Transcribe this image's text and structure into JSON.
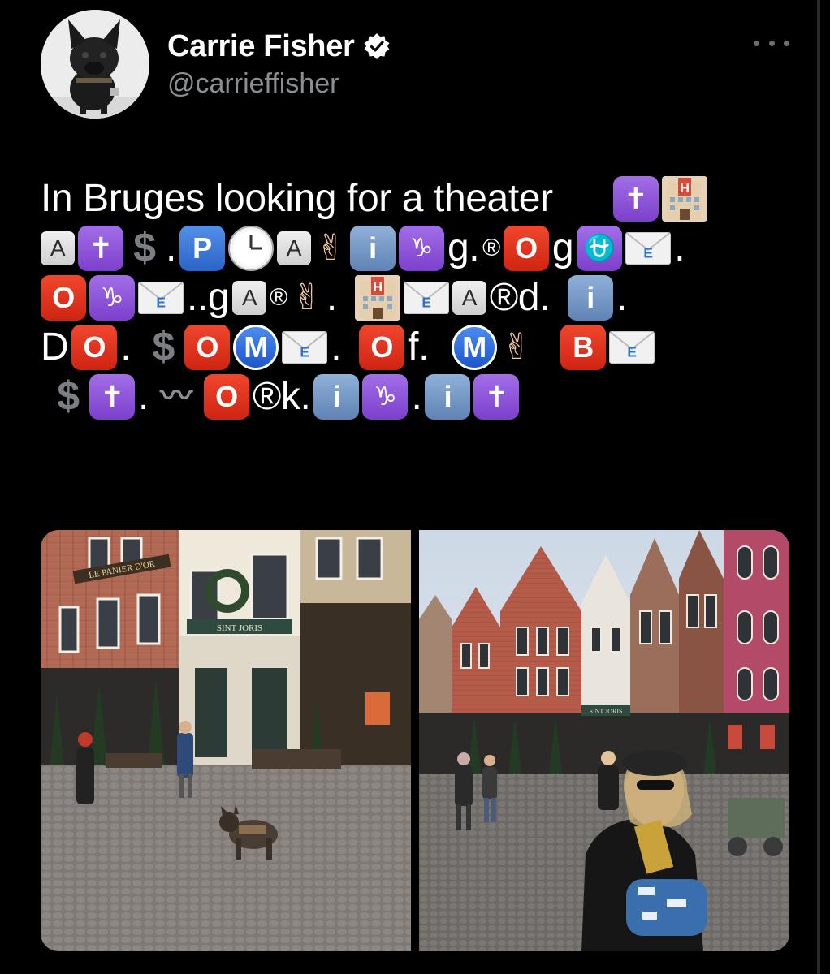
{
  "user": {
    "display_name": "Carrie Fisher",
    "handle": "@carrieffisher",
    "verified_icon": "verified-badge-icon",
    "avatar_icon": "dog-avatar-icon"
  },
  "header": {
    "more_icon": "more-options-icon"
  },
  "tweet": {
    "line1_text": "In Bruges looking for a theater",
    "line2": {
      "dot1": ".",
      "g1": "g.",
      "reg1": "®",
      "g2": "g",
      "dot2": "."
    },
    "line3": {
      "ga": "..g",
      "reg": "®",
      "dot1": ".",
      "reg_d": "®d.",
      "dot2": "."
    },
    "line4": {
      "d": "D",
      "dot1": ".",
      "dot2": ".",
      "f": "f."
    },
    "line5": {
      "dot1": ".",
      "rk": "®k.",
      "dot2": "."
    },
    "emoji": {
      "cross": "✝",
      "a": "A",
      "p": "P",
      "i": "i",
      "o": "O",
      "m": "M",
      "b": "B",
      "e": "E",
      "dollar": "$",
      "capricorn": "♑",
      "ophiuchus": "⛎",
      "wave": "〰",
      "hand": "✌"
    }
  },
  "media": {
    "left_photo_sign_1": "LE PANIER D'OR",
    "left_photo_sign_2": "SINT JORIS",
    "right_photo_sign": "SINT JORIS"
  },
  "colors": {
    "background": "#000000",
    "text": "#ffffff",
    "secondary_text": "#8b8f94",
    "verified": "#ffffff"
  }
}
